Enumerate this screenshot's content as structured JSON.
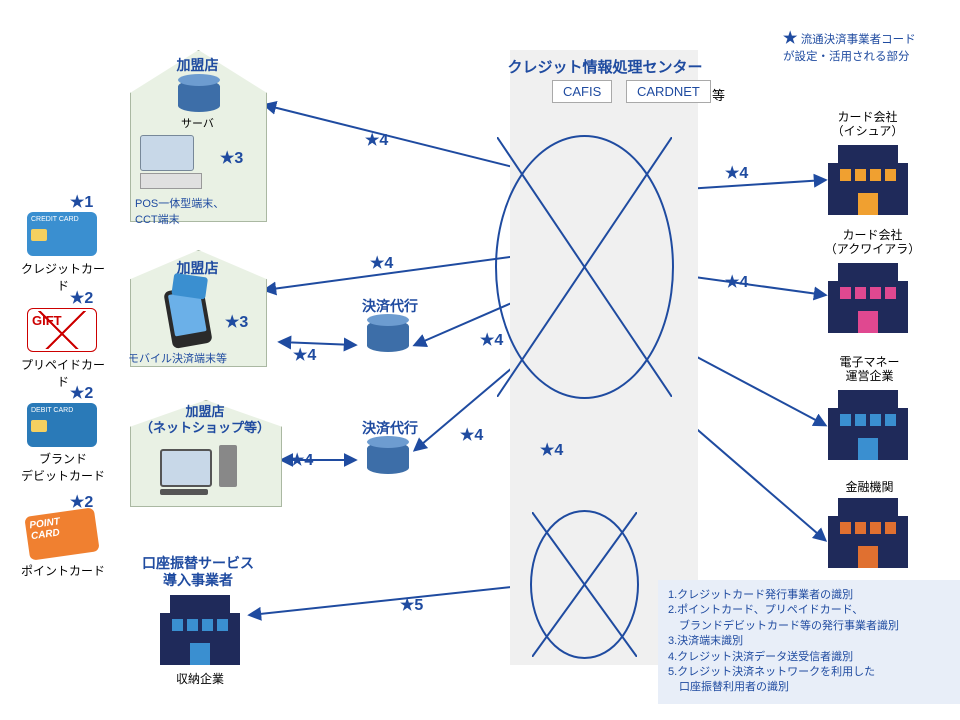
{
  "legend_star": "★",
  "legend_star_text": "流通決済事業者コード\nが設定・活用される部分",
  "center_title": "クレジット情報処理センター",
  "center_box1": "CAFIS",
  "center_box2": "CARDNET",
  "center_etc": "等",
  "cards": {
    "c1": {
      "star": "★1",
      "label": "クレジットカード",
      "badge": "CREDIT CARD"
    },
    "c2": {
      "star": "★2",
      "label": "プリペイドカード",
      "badge": "GIFT"
    },
    "c3": {
      "star": "★2",
      "label1": "ブランド",
      "label2": "デビットカード",
      "badge": "DEBIT CARD"
    },
    "c4": {
      "star": "★2",
      "label": "ポイントカード",
      "badge": "POINT CARD"
    }
  },
  "merchants": {
    "m1": {
      "title": "加盟店",
      "srv": "サーバ",
      "star": "★3",
      "sub": "POS一体型端末、\nCCT端末"
    },
    "m2": {
      "title": "加盟店",
      "star": "★3",
      "sub": "モバイル決済端末等"
    },
    "m3": {
      "title1": "加盟店",
      "title2": "（ネットショップ等）"
    }
  },
  "agent_label": "決済代行",
  "transfer_title1": "口座振替サービス",
  "transfer_title2": "導入事業者",
  "transfer_sub": "収納企業",
  "right": {
    "r1": {
      "l1": "カード会社",
      "l2": "（イシュア）"
    },
    "r2": {
      "l1": "カード会社",
      "l2": "（アクワイアラ）"
    },
    "r3": {
      "l1": "電子マネー",
      "l2": "運営企業"
    },
    "r4": {
      "l1": "金融機関"
    }
  },
  "stars": {
    "s3": "★3",
    "s4": "★4",
    "s5": "★5"
  },
  "foot": {
    "l1": "1.クレジットカード発行事業者の識別",
    "l2": "2.ポイントカード、プリペイドカード、",
    "l2b": "　ブランドデビットカード等の発行事業者識別",
    "l3": "3.決済端末識別",
    "l4": "4.クレジット決済データ送受信者識別",
    "l5": "5.クレジット決済ネットワークを利用した",
    "l5b": "　口座振替利用者の識別"
  },
  "colors": {
    "issuer": "#f0a030",
    "acquirer": "#e04890",
    "emoney": "#3a8fd0",
    "bank": "#e07030",
    "transfer": "#3a8fd0",
    "cc": "#3a8fd0",
    "gift": "#ffffff",
    "debit": "#2a7ab8",
    "point": "#f08030"
  }
}
